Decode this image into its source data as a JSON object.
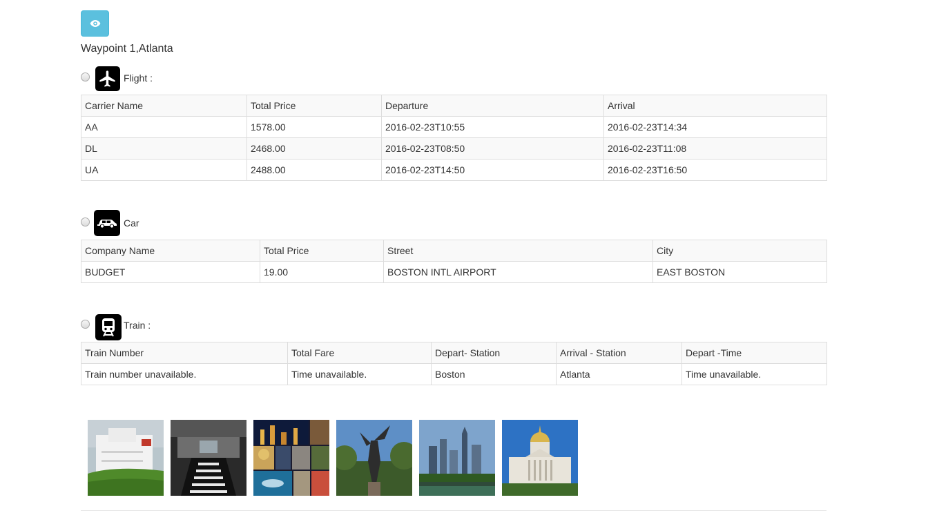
{
  "waypoint": {
    "title": "Waypoint 1,Atlanta"
  },
  "header": {
    "view_icon": "eye-icon",
    "accent": "#5bc0de"
  },
  "flight": {
    "label": "Flight :",
    "icon": "airplane-icon",
    "columns": [
      "Carrier Name",
      "Total Price",
      "Departure",
      "Arrival"
    ],
    "rows": [
      [
        "AA",
        "1578.00",
        "2016-02-23T10:55",
        "2016-02-23T14:34"
      ],
      [
        "DL",
        "2468.00",
        "2016-02-23T08:50",
        "2016-02-23T11:08"
      ],
      [
        "UA",
        "2488.00",
        "2016-02-23T14:50",
        "2016-02-23T16:50"
      ]
    ]
  },
  "car": {
    "label": "Car",
    "icon": "car-icon",
    "columns": [
      "Company Name",
      "Total Price",
      "Street",
      "City"
    ],
    "rows": [
      [
        "BUDGET",
        "19.00",
        "BOSTON INTL AIRPORT",
        "EAST BOSTON"
      ]
    ]
  },
  "train": {
    "label": "Train :",
    "icon": "train-icon",
    "columns": [
      "Train Number",
      "Total Fare",
      "Depart- Station",
      "Arrival - Station",
      "Depart -Time"
    ],
    "rows": [
      [
        "Train number unavailable.",
        "Time unavailable.",
        "Boston",
        "Atlanta",
        "Time unavailable."
      ]
    ]
  },
  "gallery": {
    "images": [
      "museum-photo",
      "aquarium-escalator-photo",
      "atlanta-collage-photo",
      "statue-photo",
      "skyline-photo",
      "capitol-photo"
    ]
  }
}
